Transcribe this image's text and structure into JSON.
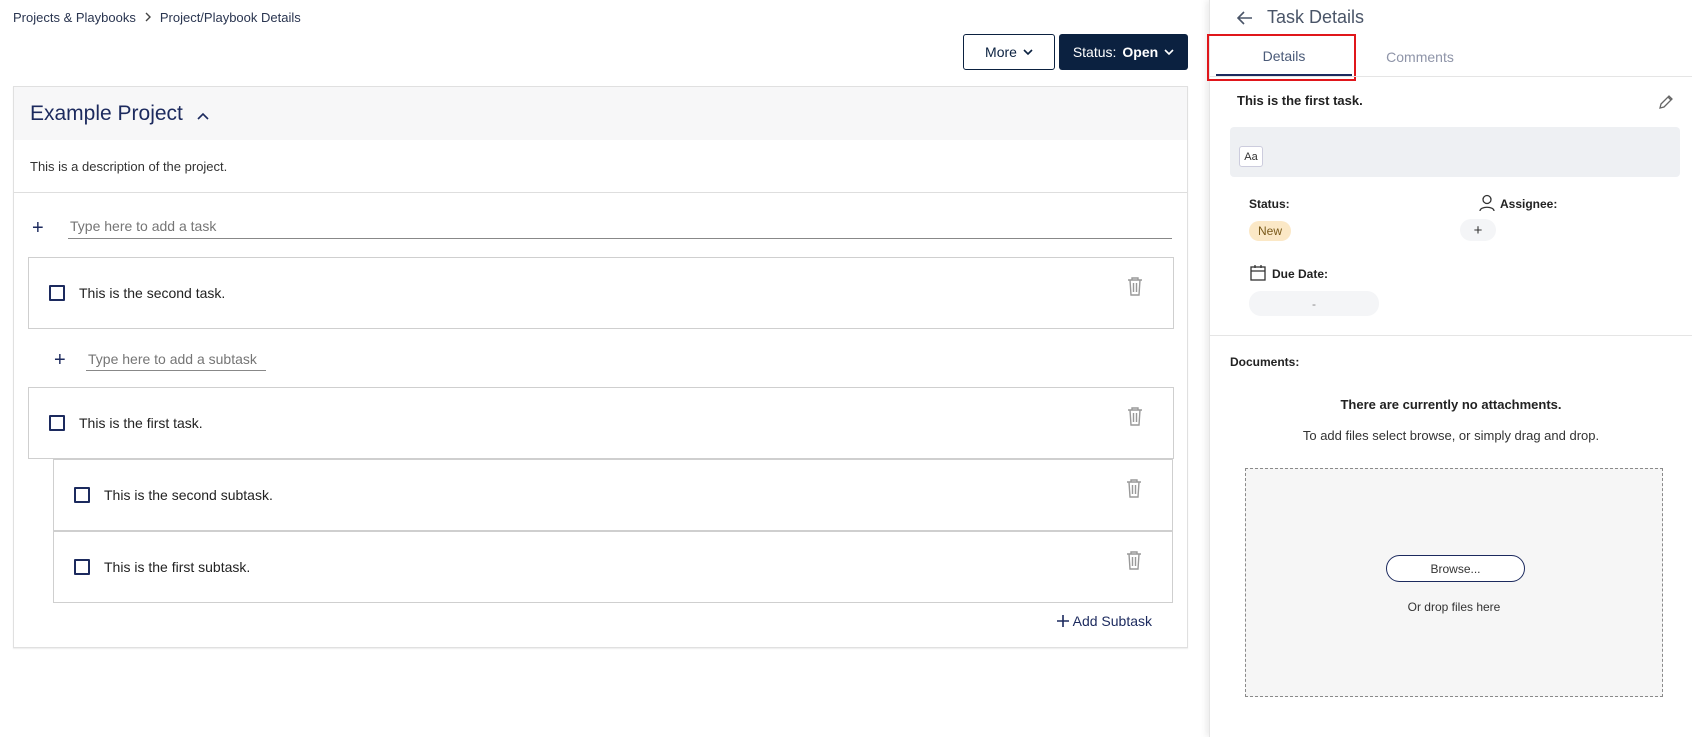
{
  "breadcrumb": {
    "items": [
      "Projects & Playbooks",
      "Project/Playbook Details"
    ],
    "separator": ">"
  },
  "header": {
    "more_label": "More",
    "status_prefix": "Status:",
    "status_value": "Open"
  },
  "project": {
    "title": "Example Project",
    "description": "This is a description of the project.",
    "add_task_placeholder": "Type here to add a task",
    "add_subtask_placeholder": "Type here to add a subtask",
    "add_subtask_button": "Add Subtask",
    "tasks": [
      {
        "label": "This is the second task."
      },
      {
        "label": "This is the first task."
      }
    ],
    "subtasks": [
      {
        "label": "This is the second subtask."
      },
      {
        "label": "This is the first subtask."
      }
    ]
  },
  "panel": {
    "title": "Task Details",
    "tabs": [
      {
        "label": "Details",
        "active": true
      },
      {
        "label": "Comments",
        "active": false
      }
    ],
    "task_name": "This is the first task.",
    "editor_button": "Aa",
    "status_label": "Status:",
    "status_value": "New",
    "assignee_label": "Assignee:",
    "assignee_add": "+",
    "due_label": "Due Date:",
    "due_value": "-",
    "documents_label": "Documents:",
    "no_attachments": "There are currently no attachments.",
    "attach_hint": "To add files select browse, or simply drag and drop.",
    "browse_label": "Browse...",
    "drop_text": "Or drop files here"
  },
  "colors": {
    "brand_navy": "#0b2140",
    "accent_title": "#1c2a5e",
    "status_new_bg": "#fbe8c6",
    "highlight_red": "#e0161b"
  }
}
